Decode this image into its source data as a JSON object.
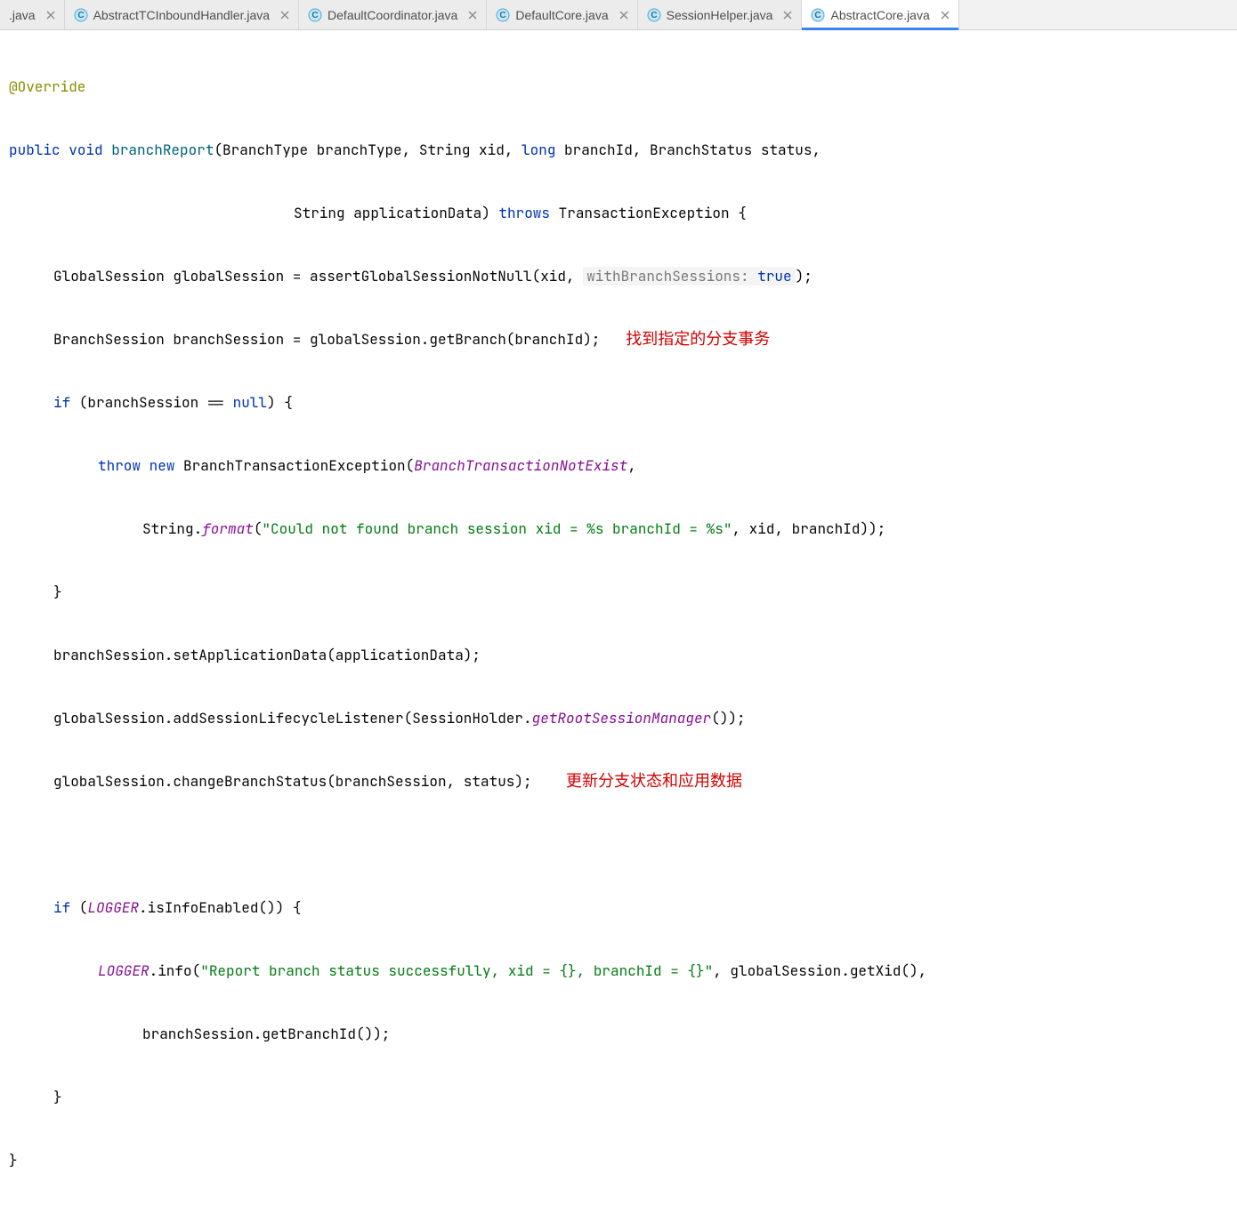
{
  "tabs": [
    {
      "label": ".java",
      "has_icon": false,
      "active": false
    },
    {
      "label": "AbstractTCInboundHandler.java",
      "has_icon": true,
      "active": false
    },
    {
      "label": "DefaultCoordinator.java",
      "has_icon": true,
      "active": false
    },
    {
      "label": "DefaultCore.java",
      "has_icon": true,
      "active": false
    },
    {
      "label": "SessionHelper.java",
      "has_icon": true,
      "active": false
    },
    {
      "label": "AbstractCore.java",
      "has_icon": true,
      "active": true
    }
  ],
  "code": {
    "annotation": "@Override",
    "kw_public": "public",
    "kw_void": "void",
    "method_name": "branchReport",
    "sig_part1": "(BranchType branchType, String xid, ",
    "kw_long": "long",
    "sig_part2": " branchId, BranchStatus status,",
    "sig_part3": "String applicationData) ",
    "kw_throws": "throws",
    "sig_part4": " TransactionException {",
    "l1_a": "GlobalSession globalSession = assertGlobalSessionNotNull(xid, ",
    "hint_label": "withBranchSessions:",
    "hint_true": "true",
    "l1_b": ");",
    "l2_a": "BranchSession branchSession = globalSession.getBranch(branchId);",
    "l2_comment": "找到指定的分支事务",
    "kw_if": "if",
    "l3_a": " (branchSession == ",
    "kw_null": "null",
    "l3_b": ") {",
    "kw_throw": "throw",
    "kw_new": "new",
    "l4_a": " BranchTransactionException(",
    "enum_val": "BranchTransactionNotExist",
    "l4_b": ",",
    "l5_a": "String.",
    "static_format": "format",
    "l5_b": "(",
    "str1": "\"Could not found branch session xid = %s branchId = %s\"",
    "l5_c": ", xid, branchId));",
    "l6": "}",
    "l7": "branchSession.setApplicationData(applicationData);",
    "l8_a": "globalSession.addSessionLifecycleListener(SessionHolder.",
    "static_getroot": "getRootSessionManager",
    "l8_b": "());",
    "l9_a": "globalSession.changeBranchStatus(branchSession, status);",
    "l9_comment": "更新分支状态和应用数据",
    "kw_if2": "if",
    "l10_a": " (",
    "logger": "LOGGER",
    "l10_b": ".isInfoEnabled()) {",
    "l11_a": ".info(",
    "str2": "\"Report branch status successfully, xid = {}, branchId = {}\"",
    "l11_b": ", globalSession.getXid(),",
    "l12": "branchSession.getBranchId());",
    "l13": "}",
    "l14": "}"
  }
}
